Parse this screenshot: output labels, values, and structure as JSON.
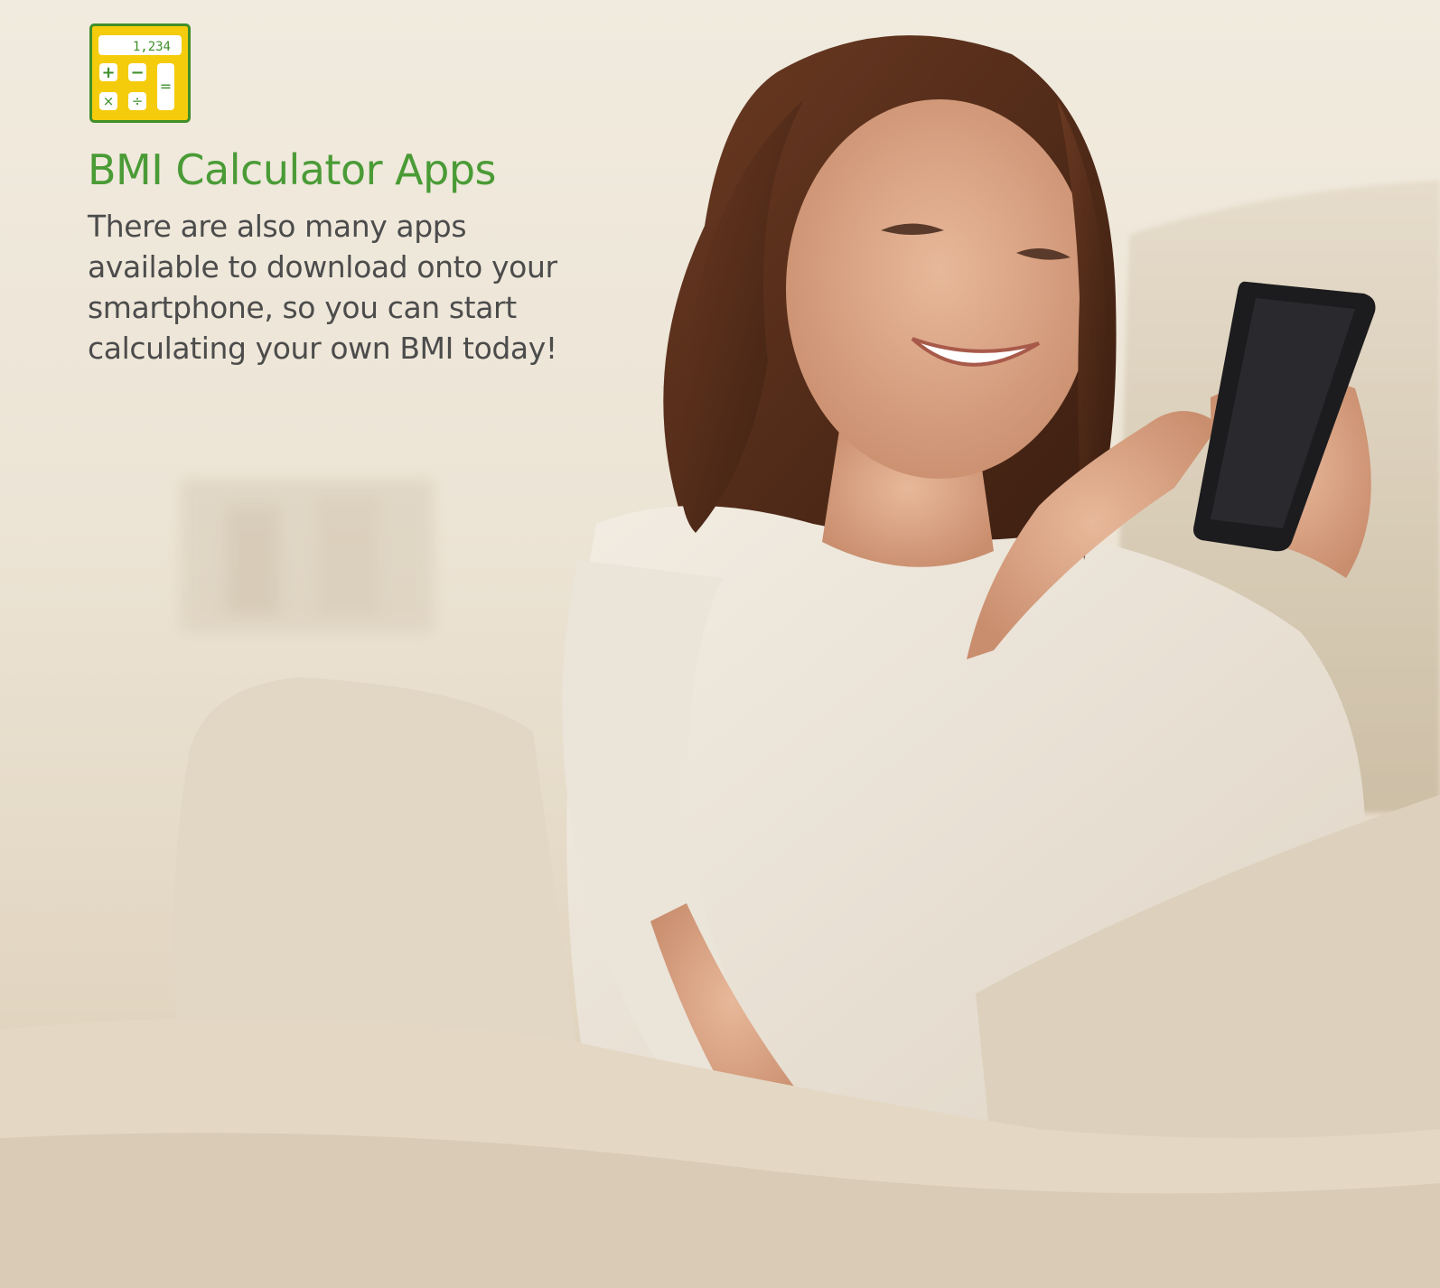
{
  "icon": {
    "name": "calculator-icon",
    "display_value": "1,234",
    "keys": [
      "+",
      "−",
      "×",
      "÷",
      "="
    ],
    "colors": {
      "frame": "#f5cc0b",
      "border": "#3f8f2a",
      "key_symbol": "#3f8f2a"
    }
  },
  "heading": "BMI Calculator Apps",
  "body": "There are also many apps available to download onto your smartphone, so you can start calculating your own BMI today!",
  "colors": {
    "heading": "#4a9b36",
    "body_text": "#4c4c4c"
  }
}
